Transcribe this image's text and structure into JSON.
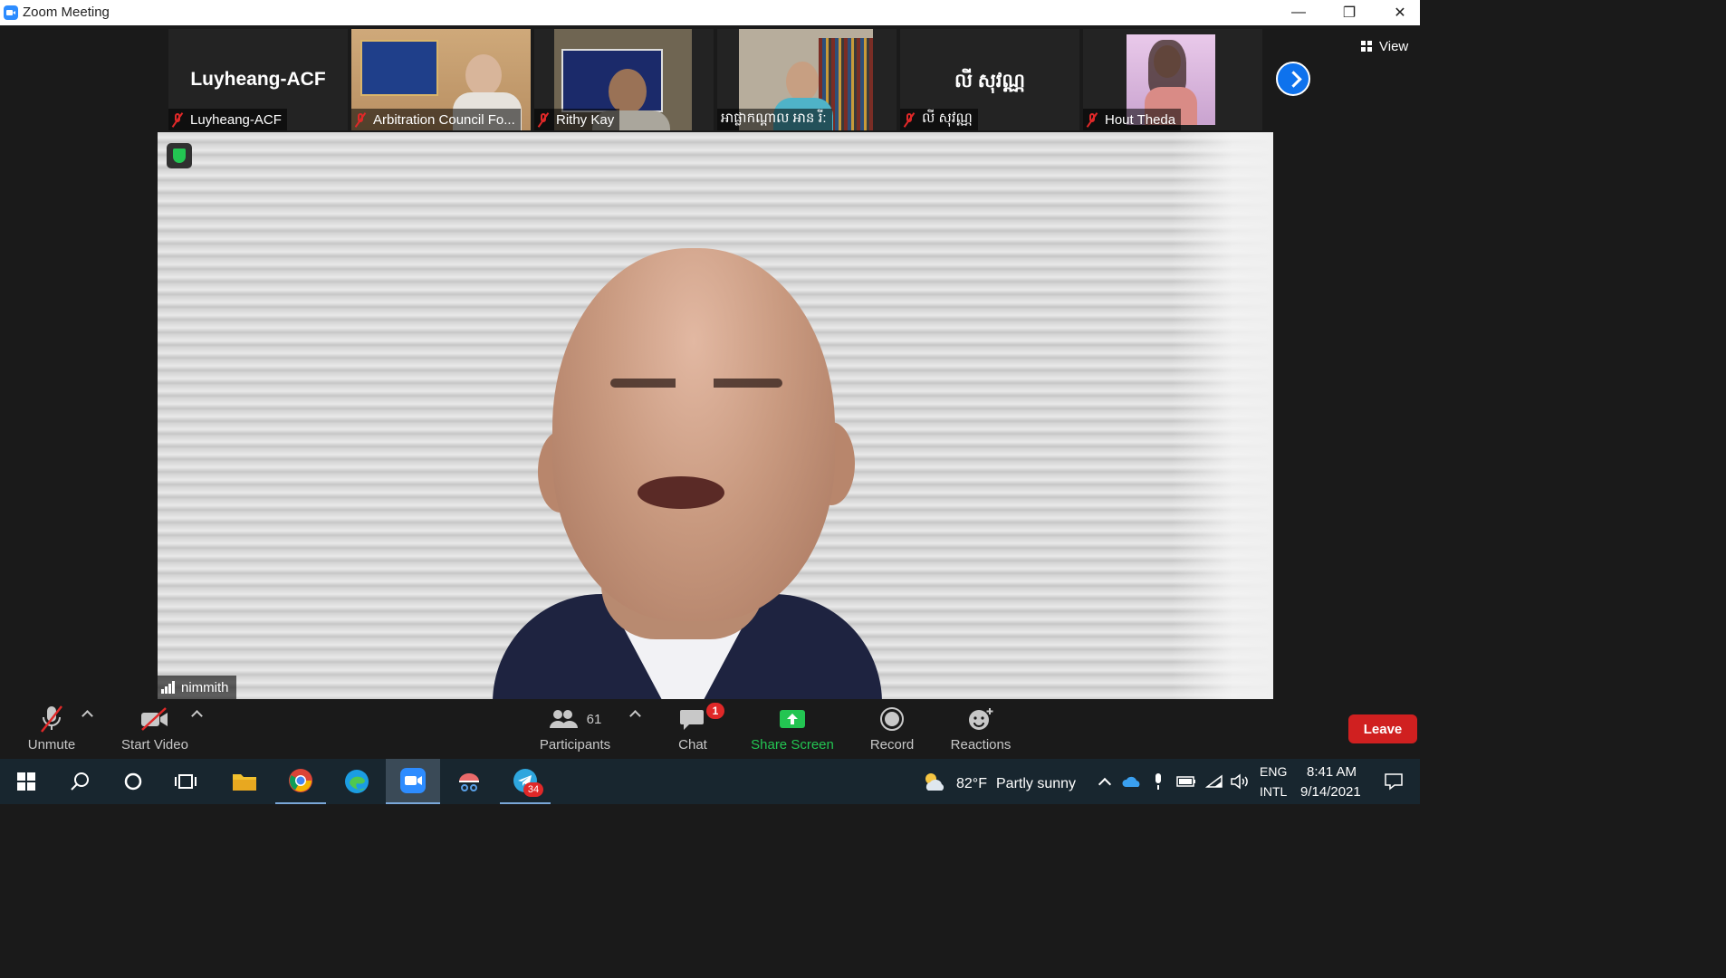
{
  "window": {
    "title": "Zoom Meeting",
    "minimize_glyph": "—",
    "restore_glyph": "❐",
    "close_glyph": "✕"
  },
  "view_button": {
    "label": "View",
    "icon": "grid-icon"
  },
  "thumbnails": [
    {
      "display_name": "Luyheang-ACF",
      "label": "Luyheang-ACF",
      "video": false
    },
    {
      "label": "Arbitration Council Fo...",
      "video": true,
      "bg": "#c9a878"
    },
    {
      "label": "Rithy Kay",
      "video": true,
      "bg": "#5a5448"
    },
    {
      "label": "អាផ្លាកណ្ដាល អាន រី:",
      "video": true,
      "bg": "#b7ad9c"
    },
    {
      "display_name": "លី សុវណ្ណ",
      "label": "លី សុវណ្ណ",
      "video": false
    },
    {
      "label": "Hout Theda",
      "video": true,
      "bg": "#c8a8c8"
    }
  ],
  "main_video": {
    "speaker_name": "nimmith",
    "encrypted_icon": "shield-check-icon"
  },
  "toolbar": {
    "unmute": "Unmute",
    "start_video": "Start Video",
    "participants": "Participants",
    "participants_count": "61",
    "chat": "Chat",
    "chat_badge": "1",
    "share_screen": "Share Screen",
    "record": "Record",
    "reactions": "Reactions",
    "leave": "Leave"
  },
  "taskbar": {
    "telegram_badge": "34",
    "weather_temp": "82°F",
    "weather_text": "Partly sunny",
    "lang_top": "ENG",
    "lang_bottom": "INTL",
    "time": "8:41 AM",
    "date": "9/14/2021"
  },
  "colors": {
    "zoom_blue": "#2d8cff",
    "share_green": "#23c552",
    "leave_red": "#d02020",
    "muted_red": "#e02828"
  }
}
